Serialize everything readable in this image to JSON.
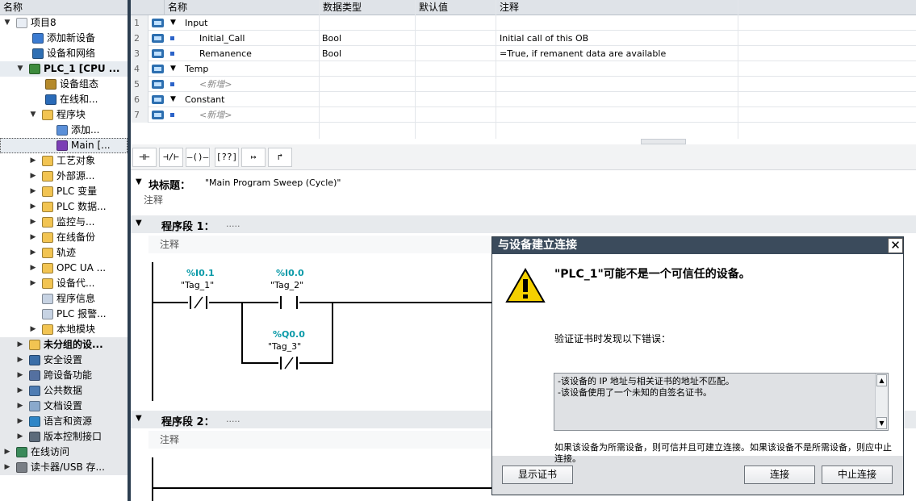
{
  "tree": {
    "header": "名称",
    "items": [
      {
        "label": "项目8",
        "icon": "project-icon",
        "arrow": "▼"
      },
      {
        "label": "添加新设备",
        "icon": "add-device-icon",
        "arrow": ""
      },
      {
        "label": "设备和网络",
        "icon": "network-icon",
        "arrow": ""
      },
      {
        "label": "PLC_1 [CPU ...",
        "icon": "plc-icon",
        "arrow": "▼"
      },
      {
        "label": "设备组态",
        "icon": "device-config-icon",
        "arrow": ""
      },
      {
        "label": "在线和...",
        "icon": "online-diag-icon",
        "arrow": ""
      },
      {
        "label": "程序块",
        "icon": "folder-icon",
        "arrow": "▼"
      },
      {
        "label": "添加...",
        "icon": "add-block-icon",
        "arrow": ""
      },
      {
        "label": "Main [...",
        "icon": "ob-block-icon",
        "arrow": ""
      },
      {
        "label": "工艺对象",
        "icon": "folder-icon",
        "arrow": "▶"
      },
      {
        "label": "外部源...",
        "icon": "folder-icon",
        "arrow": "▶"
      },
      {
        "label": "PLC 变量",
        "icon": "folder-icon",
        "arrow": "▶"
      },
      {
        "label": "PLC 数据...",
        "icon": "folder-icon",
        "arrow": "▶"
      },
      {
        "label": "监控与...",
        "icon": "folder-icon",
        "arrow": "▶"
      },
      {
        "label": "在线备份",
        "icon": "folder-icon",
        "arrow": "▶"
      },
      {
        "label": "轨迹",
        "icon": "folder-icon",
        "arrow": "▶"
      },
      {
        "label": "OPC UA ...",
        "icon": "folder-icon",
        "arrow": "▶"
      },
      {
        "label": "设备代...",
        "icon": "folder-icon",
        "arrow": "▶"
      },
      {
        "label": "程序信息",
        "icon": "document-icon",
        "arrow": ""
      },
      {
        "label": "PLC 报警...",
        "icon": "document-icon",
        "arrow": ""
      },
      {
        "label": "本地模块",
        "icon": "folder-icon",
        "arrow": "▶"
      },
      {
        "label": "未分组的设...",
        "icon": "folder-icon",
        "arrow": "▶"
      },
      {
        "label": "安全设置",
        "icon": "security-icon",
        "arrow": "▶"
      },
      {
        "label": "跨设备功能",
        "icon": "cross-device-icon",
        "arrow": "▶"
      },
      {
        "label": "公共数据",
        "icon": "common-data-icon",
        "arrow": "▶"
      },
      {
        "label": "文档设置",
        "icon": "doc-settings-icon",
        "arrow": "▶"
      },
      {
        "label": "语言和资源",
        "icon": "language-icon",
        "arrow": "▶"
      },
      {
        "label": "版本控制接口",
        "icon": "version-control-icon",
        "arrow": "▶"
      },
      {
        "label": "在线访问",
        "icon": "online-access-icon",
        "arrow": "▶"
      },
      {
        "label": "读卡器/USB 存...",
        "icon": "card-reader-icon",
        "arrow": "▶"
      }
    ]
  },
  "table": {
    "headers": [
      "名称",
      "数据类型",
      "默认值",
      "注释"
    ],
    "rows": [
      {
        "num": "1",
        "name": "Input",
        "type": "",
        "default": "",
        "comment": "",
        "section": true
      },
      {
        "num": "2",
        "name": "Initial_Call",
        "type": "Bool",
        "default": "",
        "comment": "Initial call of this OB",
        "section": false
      },
      {
        "num": "3",
        "name": "Remanence",
        "type": "Bool",
        "default": "",
        "comment": "=True, if remanent data are available",
        "section": false
      },
      {
        "num": "4",
        "name": "Temp",
        "type": "",
        "default": "",
        "comment": "",
        "section": true
      },
      {
        "num": "5",
        "name": "<新增>",
        "type": "",
        "default": "",
        "comment": "",
        "section": false,
        "placeholder": true
      },
      {
        "num": "6",
        "name": "Constant",
        "type": "",
        "default": "",
        "comment": "",
        "section": true
      },
      {
        "num": "7",
        "name": "<新增>",
        "type": "",
        "default": "",
        "comment": "",
        "section": false,
        "placeholder": true
      }
    ]
  },
  "editor": {
    "toolbar": [
      "⊣⊢",
      "⊣/⊢",
      "–()–",
      "[??]",
      "↦",
      "↱"
    ],
    "block_title_label": "块标题：",
    "block_title_value": "\"Main Program Sweep (Cycle)\"",
    "block_comment": "注释",
    "networks": [
      {
        "label": "程序段 1：",
        "title": ".....",
        "comment": "注释"
      },
      {
        "label": "程序段 2：",
        "title": ".....",
        "comment": "注释"
      }
    ],
    "contacts": [
      {
        "address": "%I0.1",
        "tag": "\"Tag_1\"",
        "kind": "nc"
      },
      {
        "address": "%I0.0",
        "tag": "\"Tag_2\"",
        "kind": "no"
      },
      {
        "address": "%Q0.0",
        "tag": "\"Tag_3\"",
        "kind": "nc"
      }
    ]
  },
  "dialog": {
    "title": "与设备建立连接",
    "heading": "\"PLC_1\"可能不是一个可信任的设备。",
    "subtitle": "验证证书时发现以下错误：",
    "errors": [
      "-该设备的 IP 地址与相关证书的地址不匹配。",
      "-该设备使用了一个未知的自签名证书。"
    ],
    "note": "如果该设备为所需设备，则可信并且可建立连接。如果该设备不是所需设备，则应中止连接。",
    "buttons": {
      "show_cert": "显示证书",
      "connect": "连接",
      "abort": "中止连接"
    },
    "warning_color": "#f5d000"
  }
}
